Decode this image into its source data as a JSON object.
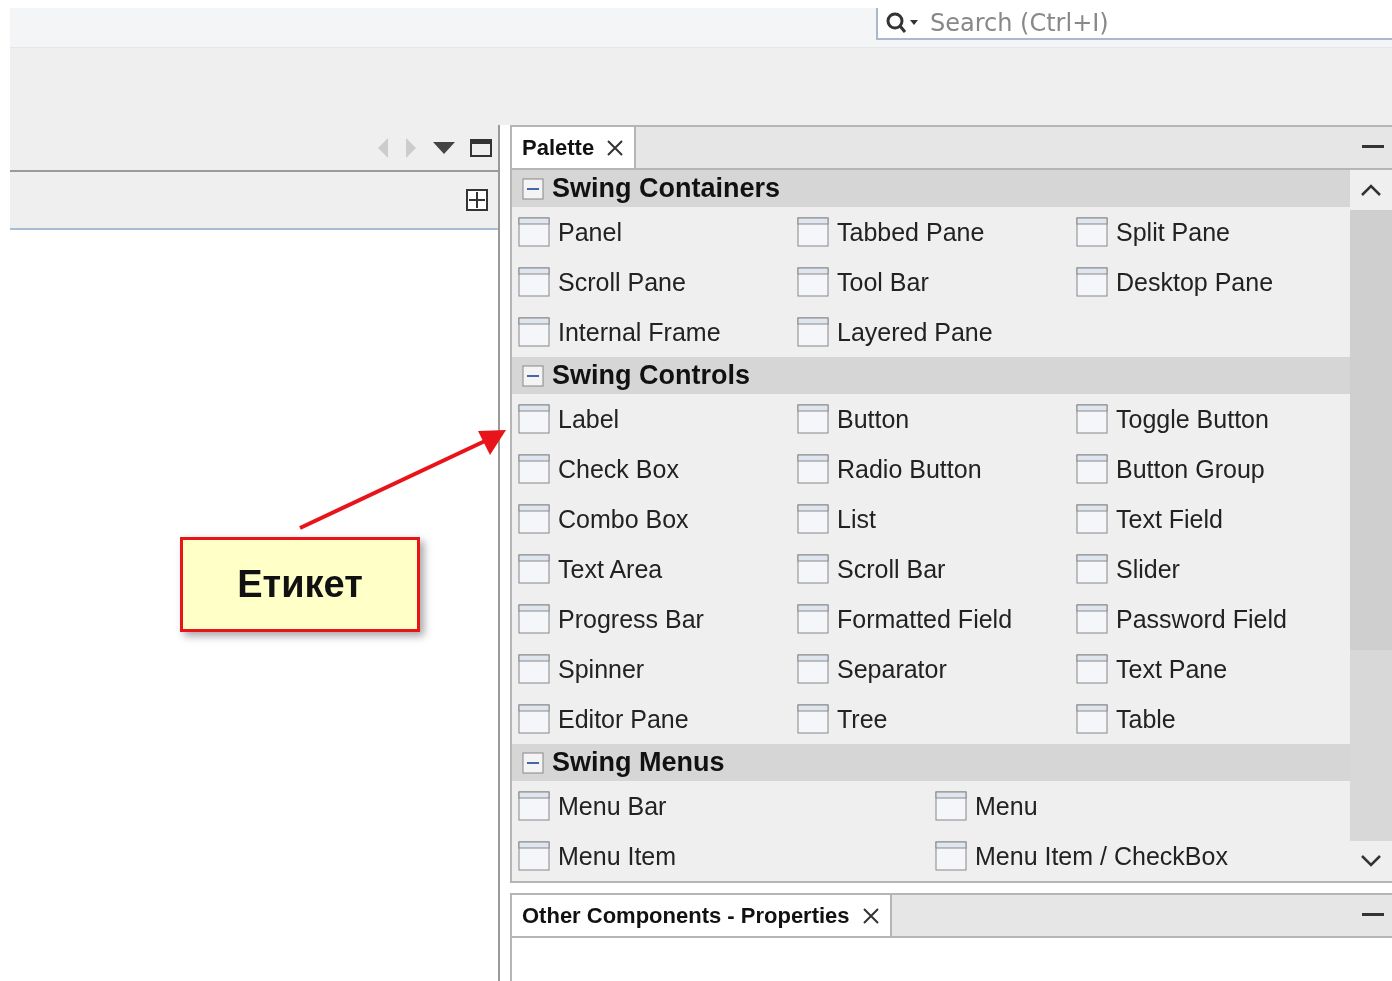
{
  "search": {
    "placeholder": "Search (Ctrl+I)"
  },
  "palette": {
    "tab": {
      "label": "Palette"
    },
    "sections": [
      {
        "title": "Swing Containers",
        "expanded": true,
        "kind": "three-column",
        "items": [
          "Panel",
          "Tabbed Pane",
          "Split Pane",
          "Scroll Pane",
          "Tool Bar",
          "Desktop Pane",
          "Internal Frame",
          "Layered Pane"
        ]
      },
      {
        "title": "Swing Controls",
        "expanded": true,
        "kind": "three-column",
        "items": [
          "Label",
          "Button",
          "Toggle Button",
          "Check Box",
          "Radio Button",
          "Button Group",
          "Combo Box",
          "List",
          "Text Field",
          "Text Area",
          "Scroll Bar",
          "Slider",
          "Progress Bar",
          "Formatted Field",
          "Password Field",
          "Spinner",
          "Separator",
          "Text Pane",
          "Editor Pane",
          "Tree",
          "Table"
        ]
      },
      {
        "title": "Swing Menus",
        "expanded": true,
        "kind": "two-column",
        "items": [
          "Menu Bar",
          "Menu",
          "Menu Item",
          "Menu Item / CheckBox"
        ]
      }
    ]
  },
  "bottom_tab": {
    "label": "Other Components - Properties"
  },
  "callout": {
    "text": "Етикет"
  }
}
